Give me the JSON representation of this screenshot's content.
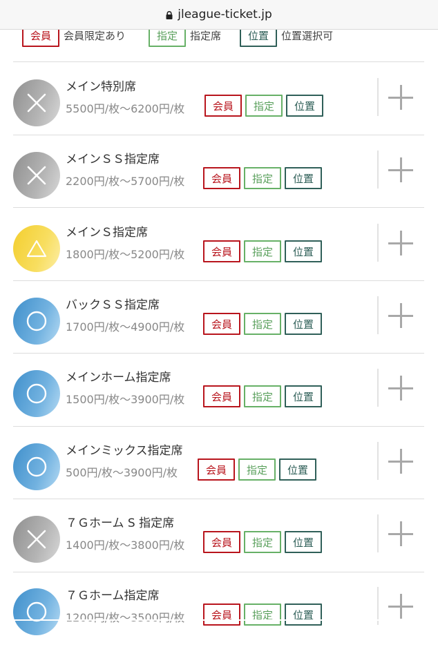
{
  "browser": {
    "url": "jleague-ticket.jp"
  },
  "legend": [
    {
      "badge": "会員",
      "text": "会員限定あり",
      "kind": "member"
    },
    {
      "badge": "指定",
      "text": "指定席",
      "kind": "assigned"
    },
    {
      "badge": "位置",
      "text": "位置選択可",
      "kind": "position"
    }
  ],
  "badges": {
    "member": "会員",
    "assigned": "指定",
    "position": "位置"
  },
  "colors": {
    "member": "#b8141c",
    "assigned": "#66b066",
    "position": "#2f5f58",
    "soldout": "#a0a0a0",
    "few": "#f5d23a",
    "available": "#4a99d2"
  },
  "seats": [
    {
      "name": "メイン特別席",
      "price": "5500円/枚〜6200円/枚",
      "status": "×",
      "status_kind": "soldout"
    },
    {
      "name": "メインＳＳ指定席",
      "price": "2200円/枚〜5700円/枚",
      "status": "×",
      "status_kind": "soldout"
    },
    {
      "name": "メインＳ指定席",
      "price": "1800円/枚〜5200円/枚",
      "status": "△",
      "status_kind": "few"
    },
    {
      "name": "バックＳＳ指定席",
      "price": "1700円/枚〜4900円/枚",
      "status": "○",
      "status_kind": "available"
    },
    {
      "name": "メインホーム指定席",
      "price": "1500円/枚〜3900円/枚",
      "status": "○",
      "status_kind": "available"
    },
    {
      "name": "メインミックス指定席",
      "price": "500円/枚〜3900円/枚",
      "status": "○",
      "status_kind": "available"
    },
    {
      "name": "７Ｇホーム S 指定席",
      "price": "1400円/枚〜3800円/枚",
      "status": "×",
      "status_kind": "soldout"
    },
    {
      "name": "７Ｇホーム指定席",
      "price": "1200円/枚〜3500円/枚",
      "status": "○",
      "status_kind": "available"
    }
  ]
}
